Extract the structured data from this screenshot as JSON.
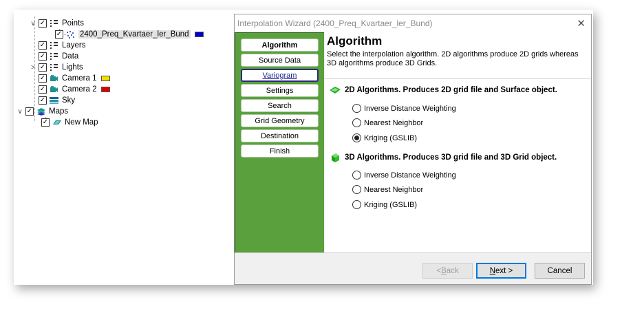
{
  "tree": {
    "items": [
      {
        "label": "Points",
        "checked": "✓",
        "expander": "∨",
        "icon": "points-icon"
      },
      {
        "label": "2400_Preq_Kvartaer_ler_Bund",
        "checked": "✓",
        "icon": "scatter-points-icon",
        "swatch": "#0000c8"
      },
      {
        "label": "Layers",
        "checked": "✓",
        "icon": "layers-icon"
      },
      {
        "label": "Data",
        "checked": "✓",
        "icon": "data-icon"
      },
      {
        "label": "Lights",
        "checked": "✓",
        "expander": ">",
        "icon": "lights-icon"
      },
      {
        "label": "Camera 1",
        "checked": "✓",
        "icon": "camera-icon",
        "swatch": "#f0e000"
      },
      {
        "label": "Camera 2",
        "checked": "✓",
        "icon": "camera-icon",
        "swatch": "#e00000"
      },
      {
        "label": "Sky",
        "checked": "✓",
        "icon": "sky-icon"
      },
      {
        "label": "Maps",
        "checked": "✓",
        "expander": "∨",
        "icon": "maps-icon"
      },
      {
        "label": "New Map",
        "checked": "✓",
        "icon": "map-icon"
      }
    ]
  },
  "dialog": {
    "title": "Interpolation Wizard (2400_Preq_Kvartaer_ler_Bund)",
    "close_glyph": "✕",
    "nav": [
      {
        "label": "Algorithm"
      },
      {
        "label": "Source Data"
      },
      {
        "label": "Variogram"
      },
      {
        "label": "Settings"
      },
      {
        "label": "Search"
      },
      {
        "label": "Grid Geometry"
      },
      {
        "label": "Destination"
      },
      {
        "label": "Finish"
      }
    ],
    "heading": "Algorithm",
    "description": "Select the interpolation algorithm. 2D algorithms produce 2D grids whereas 3D algorithms produce 3D Grids.",
    "group2d": {
      "title": "2D Algorithms. Produces 2D grid file and Surface object.",
      "options": [
        "Inverse Distance Weighting",
        "Nearest Neighbor",
        "Kriging (GSLIB)"
      ],
      "selected": "Kriging (GSLIB)"
    },
    "group3d": {
      "title": "3D Algorithms. Produces 3D grid file and 3D Grid object.",
      "options": [
        "Inverse Distance Weighting",
        "Nearest Neighbor",
        "Kriging (GSLIB)"
      ],
      "selected": ""
    },
    "buttons": {
      "back_prefix": "< ",
      "back_accel": "B",
      "back_rest": "ack",
      "next_accel": "N",
      "next_rest": "ext >",
      "cancel": "Cancel"
    }
  },
  "colors": {
    "nav_green": "#5aa03c",
    "primary_border": "#0078d7"
  }
}
